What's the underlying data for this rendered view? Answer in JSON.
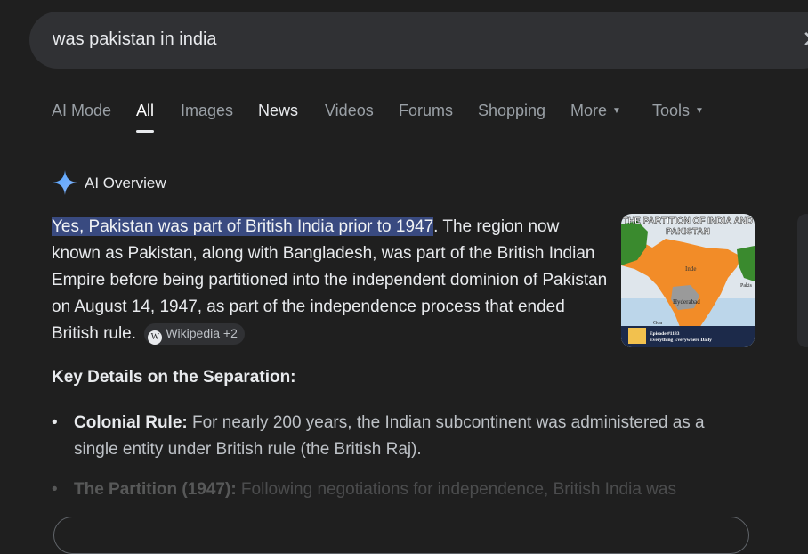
{
  "search": {
    "query": "was pakistan in india",
    "clear_icon": "close-icon"
  },
  "tabs": [
    {
      "label": "AI Mode"
    },
    {
      "label": "All"
    },
    {
      "label": "Images"
    },
    {
      "label": "News"
    },
    {
      "label": "Videos"
    },
    {
      "label": "Forums"
    },
    {
      "label": "Shopping"
    },
    {
      "label": "More"
    },
    {
      "label": "Tools"
    }
  ],
  "ai_overview": {
    "title": "AI Overview",
    "icon": "sparkle-icon",
    "highlight": "Yes, Pakistan was part of British India prior to 1947",
    "text": ". The region now known as Pakistan, along with Bangladesh, was part of the British Indian Empire before being partitioned into the independent dominion of Pakistan on August 14, 1947, as part of the independence process that ended British rule.",
    "source_chip": "Wikipedia +2",
    "image": {
      "title": "THE PARTITION OF INDIA AND PAKISTAN",
      "labels": [
        "Inde",
        "Hyderabad",
        "Pakistan",
        "Goa"
      ],
      "caption_1": "Episode #1183",
      "caption_2": "Everything Everywhere Daily"
    }
  },
  "section_title": "Key Details on the Separation:",
  "bullets": [
    {
      "head": "Colonial Rule:",
      "text": " For nearly 200 years, the Indian subcontinent was administered as a single entity under British rule (the British Raj)."
    },
    {
      "head": "The Partition (1947):",
      "text": " Following negotiations for independence, British India was"
    }
  ],
  "colors": {
    "background": "#1f1f1f",
    "search_bg": "#303134",
    "highlight": "#394a80",
    "map_orange": "#f28c28",
    "map_green": "#3a8a2e"
  }
}
